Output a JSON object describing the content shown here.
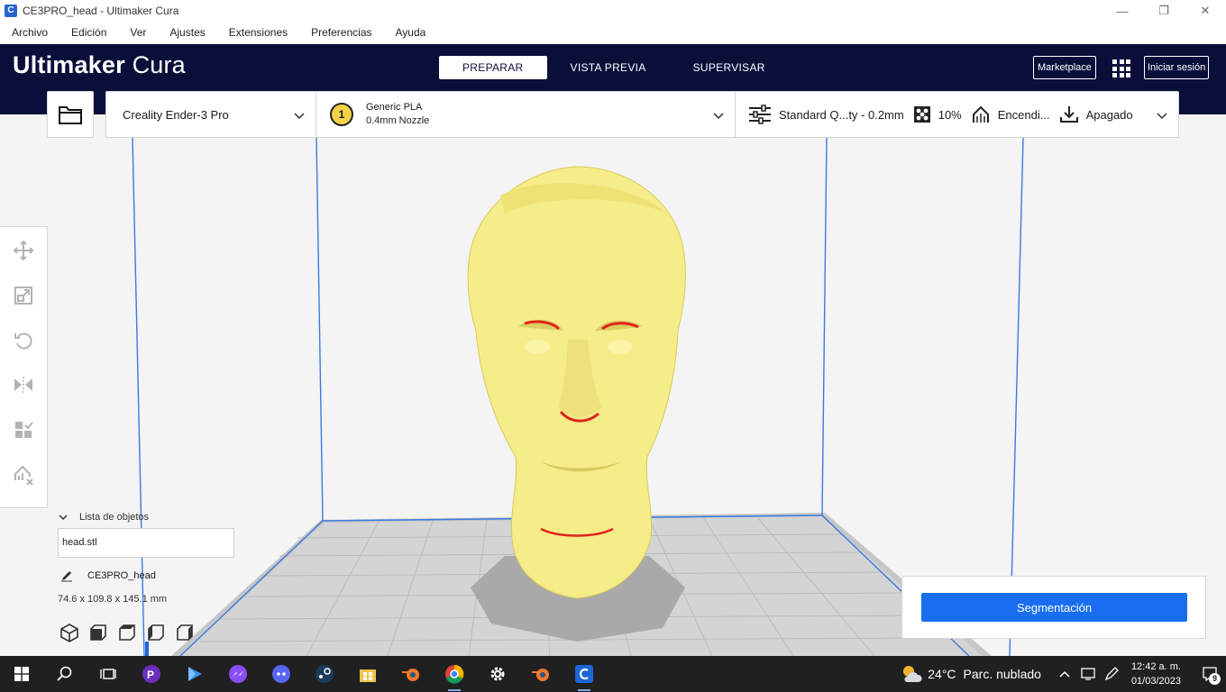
{
  "window": {
    "title": "CE3PRO_head - Ultimaker Cura",
    "minimize_glyph": "—",
    "restore_glyph": "❐",
    "close_glyph": "✕"
  },
  "menu": [
    "Archivo",
    "Edición",
    "Ver",
    "Ajustes",
    "Extensiones",
    "Preferencias",
    "Ayuda"
  ],
  "header": {
    "logo_bold": "Ultimaker",
    "logo_light": "Cura",
    "stages": [
      {
        "label": "PREPARAR",
        "active": true
      },
      {
        "label": "VISTA PREVIA",
        "active": false
      },
      {
        "label": "SUPERVISAR",
        "active": false
      }
    ],
    "marketplace_label": "Marketplace",
    "signin_label": "Iniciar sesión"
  },
  "toolbar": {
    "printer": "Creality Ender-3 Pro",
    "extruder_number": "1",
    "material": "Generic PLA",
    "nozzle": "0.4mm Nozzle",
    "profile": "Standard Q...ty - 0.2mm",
    "infill": "10%",
    "support": "Encendi...",
    "adhesion": "Apagado"
  },
  "objects": {
    "header": "Lista de objetos",
    "items": [
      "head.stl"
    ],
    "job_name": "CE3PRO_head",
    "dimensions": "74.6 x 109.8 x 145.1 mm"
  },
  "action": {
    "slice_label": "Segmentación"
  },
  "taskbar": {
    "weather_temp": "24°C",
    "weather_desc": "Parc. nublado",
    "time": "12:42 a. m.",
    "date": "01/03/2023",
    "notification_count": "9"
  },
  "colors": {
    "header_bg": "#0a0f3a",
    "accent_blue": "#196ef0",
    "model_yellow": "#f5ec8a",
    "overhang_red": "#e0241b"
  }
}
